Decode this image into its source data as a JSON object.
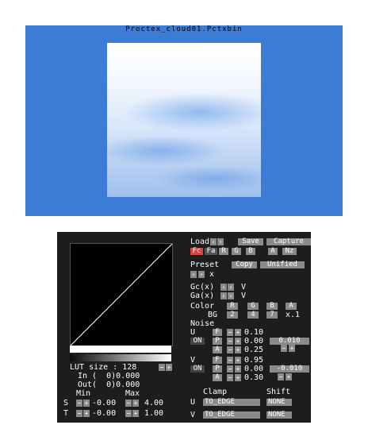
{
  "preview": {
    "title": "Proctex_cloud01.Pctxbin"
  },
  "lut": {
    "size_label": "LUT size : 128",
    "in_label": "In (  0)0.000",
    "out_label": "Out(  0)0.000",
    "min_label": "Min",
    "max_label": "Max",
    "s_label": "S",
    "t_label": "T",
    "s_min": "-0.00",
    "s_max": "4.00",
    "t_min": "-0.00",
    "t_max": "1.00"
  },
  "toolbar": {
    "load": "Load",
    "save": "Save",
    "capture": "Capture",
    "tabs": [
      "Fc",
      "Fa",
      "R",
      "G",
      "B",
      "A",
      "Nz"
    ],
    "active_tab": "Fc"
  },
  "preset": {
    "label": "Preset",
    "copy": "Copy",
    "unified": "Unified",
    "x": "x"
  },
  "gc": {
    "label": "Gc(x)",
    "value": "V"
  },
  "ga": {
    "label": "Ga(x)",
    "value": "V"
  },
  "color": {
    "label": "Color",
    "channels": [
      "R",
      "G",
      "B",
      "A"
    ],
    "bg_label": "BG",
    "bg_values": [
      "2",
      "4",
      "7"
    ],
    "bg_mult": "x.1"
  },
  "noise": {
    "label": "Noise",
    "u": {
      "axis": "U",
      "toggle": "ON",
      "f": "0.10",
      "p": "0.00",
      "p_extra": "0.010",
      "a": "0.25"
    },
    "v": {
      "axis": "V",
      "toggle": "ON",
      "f": "0.95",
      "p": "0.00",
      "p_extra": "-0.010",
      "a": "0.30"
    },
    "f_label": "F",
    "p_label": "P",
    "a_label": "A"
  },
  "clamp": {
    "clamp_header": "Clamp",
    "shift_header": "Shift",
    "u_axis": "U",
    "v_axis": "V",
    "u_clamp": "TO_EDGE",
    "v_clamp": "TO_EDGE",
    "u_shift": "NONE",
    "v_shift": "NONE"
  },
  "colors": {
    "preview_bg": "#3c7bd6",
    "panel_bg": "#1d1d1d",
    "button": "#8a8a8a",
    "active": "#d44545"
  }
}
